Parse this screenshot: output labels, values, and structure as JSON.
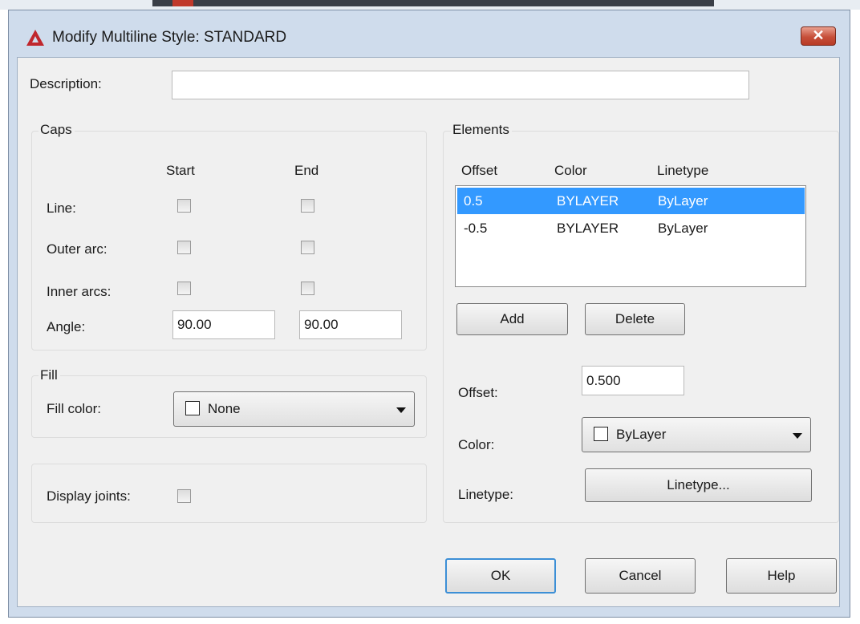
{
  "window": {
    "title": "Modify Multiline Style: STANDARD",
    "close_glyph": "✕",
    "icon": "autocad-a-icon"
  },
  "description": {
    "label": "Description:",
    "value": ""
  },
  "caps": {
    "title": "Caps",
    "start_label": "Start",
    "end_label": "End",
    "line_label": "Line:",
    "outer_arc_label": "Outer arc:",
    "inner_arcs_label": "Inner arcs:",
    "angle_label": "Angle:",
    "angle_start": "90.00",
    "angle_end": "90.00"
  },
  "fill": {
    "title": "Fill",
    "color_label": "Fill color:",
    "color_value": "None"
  },
  "joints": {
    "label": "Display joints:"
  },
  "elements": {
    "title": "Elements",
    "columns": [
      "Offset",
      "Color",
      "Linetype"
    ],
    "rows": [
      {
        "offset": "0.5",
        "color": "BYLAYER",
        "linetype": "ByLayer",
        "selected": true
      },
      {
        "offset": "-0.5",
        "color": "BYLAYER",
        "linetype": "ByLayer",
        "selected": false
      }
    ],
    "add_label": "Add",
    "delete_label": "Delete",
    "offset_label": "Offset:",
    "offset_value": "0.500",
    "color_label": "Color:",
    "color_value": "ByLayer",
    "linetype_label": "Linetype:",
    "linetype_button": "Linetype..."
  },
  "buttons": {
    "ok": "OK",
    "cancel": "Cancel",
    "help": "Help"
  },
  "colors": {
    "accent": "#3399ff",
    "frame": "#cfdcec",
    "client": "#f0f0f0",
    "close": "#c7503a",
    "icon_red": "#c0272d"
  }
}
